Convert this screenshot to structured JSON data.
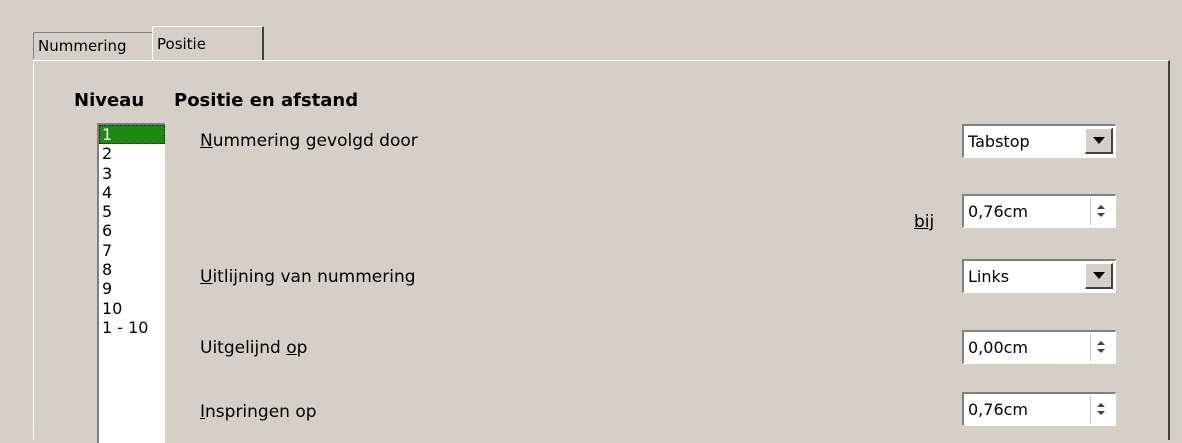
{
  "tabs": [
    {
      "label": "Nummering"
    },
    {
      "label": "Positie"
    }
  ],
  "headings": {
    "level": "Niveau",
    "position": "Positie en afstand"
  },
  "levels": [
    "1",
    "2",
    "3",
    "4",
    "5",
    "6",
    "7",
    "8",
    "9",
    "10",
    "1 - 10"
  ],
  "selected_level": "1",
  "fields": {
    "numbering_followed_by": {
      "label_first": "N",
      "label_rest": "ummering gevolgd door",
      "value": "Tabstop"
    },
    "at": {
      "label": "bij",
      "value": "0,76cm"
    },
    "alignment": {
      "label_first": "U",
      "label_rest": "itlijning van nummering",
      "value": "Links"
    },
    "aligned_at": {
      "label_start": "Uitgelijnd ",
      "label_ul": "o",
      "label_end": "p",
      "value": "0,00cm"
    },
    "indent_at": {
      "label_first": "I",
      "label_rest": "nspringen op",
      "value": "0,76cm"
    }
  }
}
